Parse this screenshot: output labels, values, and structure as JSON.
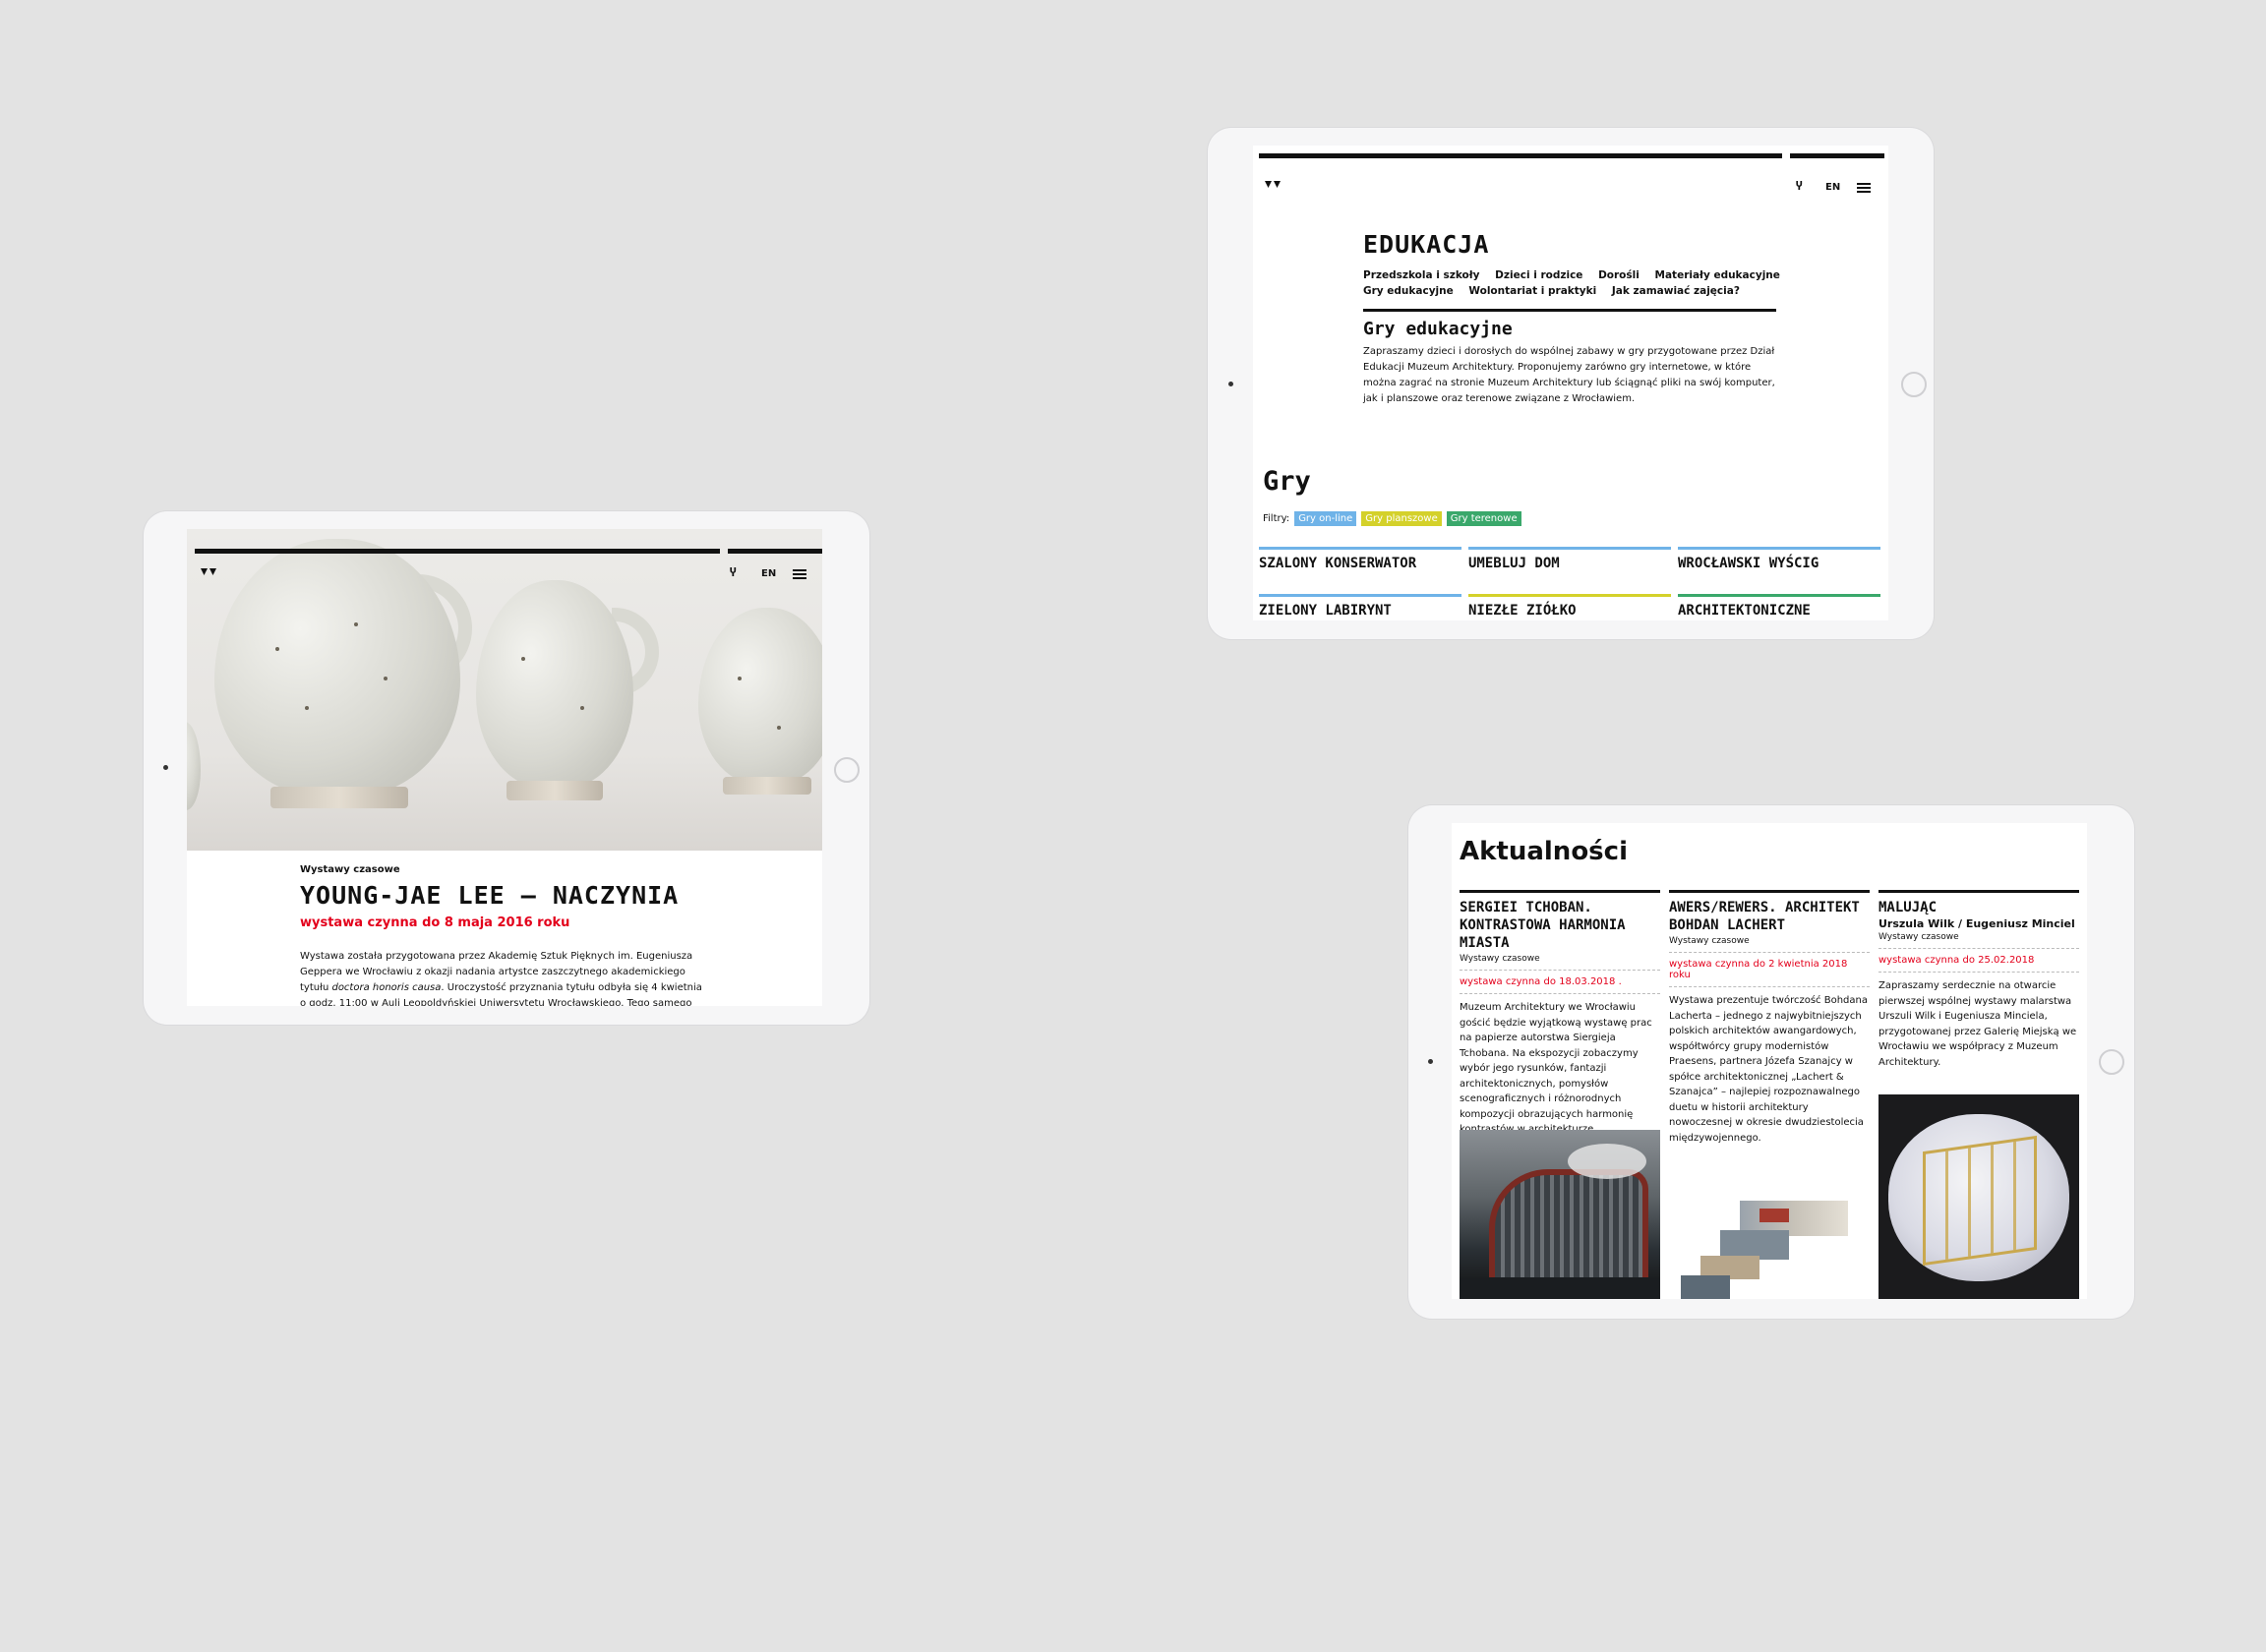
{
  "edukacja": {
    "nav": {
      "lang": "EN"
    },
    "title": "EDUKACJA",
    "links": [
      "Przedszkola i szkoły",
      "Dzieci i rodzice",
      "Dorośli",
      "Materiały edukacyjne",
      "Gry edukacyjne",
      "Wolontariat i praktyki",
      "Jak zamawiać zajęcia?"
    ],
    "subtitle": "Gry edukacyjne",
    "text": "Zapraszamy dzieci i dorosłych do wspólnej zabawy w gry przygotowane przez Dział Edukacji Muzeum Architektury. Proponujemy zarówno gry internetowe, w które można zagrać na stronie Muzeum Architektury lub ściągnąć pliki na swój komputer, jak i planszowe oraz terenowe związane z Wrocławiem.",
    "games_title": "Gry",
    "filters_label": "Filtry:",
    "filters": [
      {
        "label": "Gry on-line",
        "color": "#6fb3e8"
      },
      {
        "label": "Gry planszowe",
        "color": "#d4d12a"
      },
      {
        "label": "Gry terenowe",
        "color": "#3aa86b"
      }
    ],
    "games": [
      {
        "label": "SZALONY KONSERWATOR",
        "color": "#6fb3e8"
      },
      {
        "label": "UMEBLUJ DOM",
        "color": "#6fb3e8"
      },
      {
        "label": "WROCŁAWSKI WYŚCIG",
        "color": "#6fb3e8"
      },
      {
        "label": "ZIELONY LABIRYNT",
        "color": "#6fb3e8"
      },
      {
        "label": "NIEZŁE ZIÓŁKO",
        "color": "#d4d12a"
      },
      {
        "label": "ARCHITEKTONICZNE",
        "color": "#3aa86b"
      }
    ]
  },
  "exhibition": {
    "nav": {
      "lang": "EN"
    },
    "category": "Wystawy czasowe",
    "title": "YOUNG-JAE LEE – NACZYNIA",
    "date": "wystawa czynna do 8 maja 2016 roku",
    "body_1": "Wystawa została przygotowana przez Akademię Sztuk Pięknych im. Eugeniusza Geppera we Wrocławiu z okazji nadania artystce zaszczytnego akademickiego tytułu",
    "body_em": "doctora honoris causa",
    "body_2": ". Uroczystość przyznania tytułu odbyła się 4 kwietnia o godz. 11:00 w Auli Leopoldyńskiej Uniwersytetu Wrocławskiego. Tego samego dnia nastąpi-",
    "accent": "#e3001b"
  },
  "news": {
    "title": "Aktualności",
    "items": [
      {
        "title": "SERGIEI TCHOBAN. KONTRASTOWA HARMONIA MIASTA",
        "author": "",
        "category": "Wystawy czasowe",
        "date": "wystawa czynna do 18.03.2018 .",
        "body": "Muzeum Architektury we Wrocławiu gościć będzie wyjątkową wystawę prac na papierze autorstwa Siergieja Tchobana. Na ekspozycji zobaczymy wybór jego rysunków, fantazji architektonicznych, pomysłów scenograficznych i różnorodnych kompozycji obrazujących harmonię kontrastów w architekturze."
      },
      {
        "title": "AWERS/REWERS. ARCHITEKT BOHDAN LACHERT",
        "author": "",
        "category": "Wystawy czasowe",
        "date": "wystawa czynna do 2 kwietnia 2018 roku",
        "body": "Wystawa prezentuje twórczość Bohdana Lacherta – jednego z najwybitniejszych polskich architektów awangardowych, współtwórcy grupy modernistów Praesens, partnera Józefa Szanajcy w spółce architektonicznej „Lachert & Szanajca” – najlepiej rozpoznawalnego duetu w historii architektury nowoczesnej w okresie dwudziestolecia międzywojennego."
      },
      {
        "title": "MALUJĄC",
        "author": "Urszula Wilk / Eugeniusz Minciel",
        "category": "Wystawy czasowe",
        "date": "wystawa czynna do 25.02.2018",
        "body": "Zapraszamy serdecznie na otwarcie pierwszej wspólnej wystawy malarstwa Urszuli Wilk i Eugeniusza Minciela, przygotowanej przez Galerię Miejską we Wrocławiu we współpracy z Muzeum Architektury."
      }
    ]
  }
}
